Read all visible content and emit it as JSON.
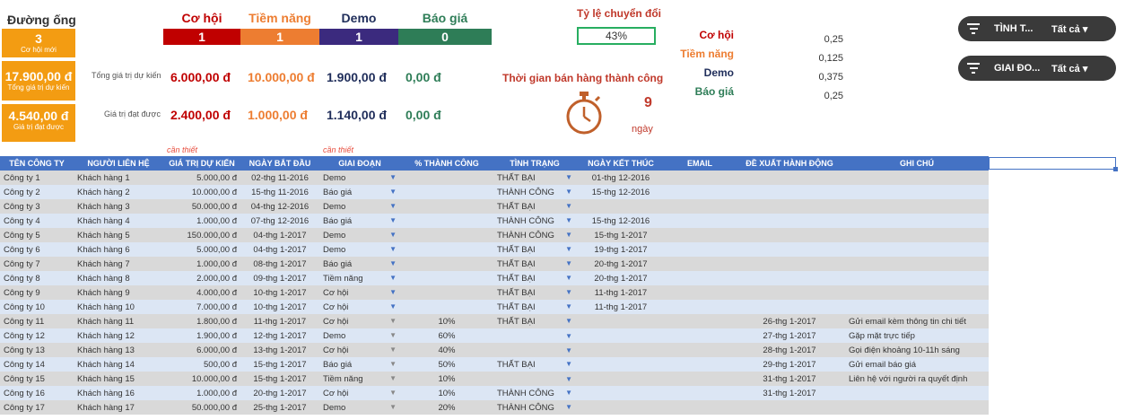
{
  "pipeline": {
    "title": "Đường ống",
    "kpis": [
      {
        "value": "3",
        "label": "Cơ hội mới"
      },
      {
        "value": "17.900,00 đ",
        "label": "Tổng giá trị dự kiến"
      },
      {
        "value": "4.540,00 đ",
        "label": "Giá trị đạt được"
      }
    ]
  },
  "stages": [
    {
      "name": "Cơ hội",
      "count": "1",
      "expected": "6.000,00 đ",
      "achieved": "2.400,00 đ",
      "color": "#c00000",
      "text_color": "#c00000"
    },
    {
      "name": "Tiềm năng",
      "count": "1",
      "expected": "10.000,00 đ",
      "achieved": "1.000,00 đ",
      "color": "#ed7d31",
      "text_color": "#ed7d31"
    },
    {
      "name": "Demo",
      "count": "1",
      "expected": "1.900,00 đ",
      "achieved": "1.140,00 đ",
      "color": "#3b2a7e",
      "text_color": "#1f2d5a"
    },
    {
      "name": "Báo giá",
      "count": "0",
      "expected": "0,00 đ",
      "achieved": "0,00 đ",
      "color": "#2e7d57",
      "text_color": "#2e7d57"
    }
  ],
  "row_labels": {
    "expected": "Tổng giá trị dự kiến",
    "achieved": "Giá trị đạt được"
  },
  "conversion": {
    "title": "Tỷ lệ chuyển đổi",
    "value": "43%"
  },
  "sales_cycle": {
    "title": "Thời gian bán hàng thành công",
    "value": "9",
    "unit": "ngày"
  },
  "rates": [
    {
      "label": "Cơ hội",
      "value": "0,25",
      "color": "#c00000"
    },
    {
      "label": "Tiềm năng",
      "value": "0,125",
      "color": "#ed7d31"
    },
    {
      "label": "Demo",
      "value": "0,375",
      "color": "#1f2d5a"
    },
    {
      "label": "Báo giá",
      "value": "0,25",
      "color": "#2e7d57"
    }
  ],
  "slicers": [
    {
      "name": "TÌNH T...",
      "value": "Tất cả"
    },
    {
      "name": "GIAI ĐO...",
      "value": "Tất cả"
    }
  ],
  "required_note": "cần thiết",
  "table": {
    "headers": [
      "TÊN CÔNG TY",
      "NGƯỜI LIÊN HỆ",
      "GIÁ TRỊ DỰ KIẾN",
      "NGÀY BẮT ĐẦU",
      "GIAI ĐOẠN",
      "% THÀNH CÔNG",
      "TÌNH TRẠNG",
      "NGÀY KẾT THÚC",
      "EMAIL",
      "ĐỀ XUẤT HÀNH ĐỘNG",
      "GHI CHÚ"
    ],
    "rows": [
      [
        "Công ty 1",
        "Khách hàng 1",
        "5.000,00 đ",
        "02-thg 11-2016",
        "Demo",
        "",
        "THẤT BẠI",
        "01-thg 12-2016",
        "",
        "",
        ""
      ],
      [
        "Công ty 2",
        "Khách hàng 2",
        "10.000,00 đ",
        "15-thg 11-2016",
        "Báo giá",
        "",
        "THÀNH CÔNG",
        "15-thg 12-2016",
        "",
        "",
        ""
      ],
      [
        "Công ty 3",
        "Khách hàng 3",
        "50.000,00 đ",
        "04-thg 12-2016",
        "Demo",
        "",
        "THẤT BẠI",
        "",
        "",
        "",
        ""
      ],
      [
        "Công ty 4",
        "Khách hàng 4",
        "1.000,00 đ",
        "07-thg 12-2016",
        "Báo giá",
        "",
        "THÀNH CÔNG",
        "15-thg 12-2016",
        "",
        "",
        ""
      ],
      [
        "Công ty 5",
        "Khách hàng 5",
        "150.000,00 đ",
        "04-thg 1-2017",
        "Demo",
        "",
        "THÀNH CÔNG",
        "15-thg 1-2017",
        "",
        "",
        ""
      ],
      [
        "Công ty 6",
        "Khách hàng 6",
        "5.000,00 đ",
        "04-thg 1-2017",
        "Demo",
        "",
        "THẤT BẠI",
        "19-thg 1-2017",
        "",
        "",
        ""
      ],
      [
        "Công ty 7",
        "Khách hàng 7",
        "1.000,00 đ",
        "08-thg 1-2017",
        "Báo giá",
        "",
        "THẤT BẠI",
        "20-thg 1-2017",
        "",
        "",
        ""
      ],
      [
        "Công ty 8",
        "Khách hàng 8",
        "2.000,00 đ",
        "09-thg 1-2017",
        "Tiềm năng",
        "",
        "THẤT BẠI",
        "20-thg 1-2017",
        "",
        "",
        ""
      ],
      [
        "Công ty 9",
        "Khách hàng 9",
        "4.000,00 đ",
        "10-thg 1-2017",
        "Cơ hội",
        "",
        "THẤT BẠI",
        "11-thg 1-2017",
        "",
        "",
        ""
      ],
      [
        "Công ty 10",
        "Khách hàng 10",
        "7.000,00 đ",
        "10-thg 1-2017",
        "Cơ hội",
        "",
        "THẤT BẠI",
        "11-thg 1-2017",
        "",
        "",
        ""
      ],
      [
        "Công ty 11",
        "Khách hàng 11",
        "1.800,00 đ",
        "11-thg 1-2017",
        "Cơ hội",
        "10%",
        "THẤT BẠI",
        "",
        "",
        "26-thg 1-2017",
        "Gửi email kèm thông tin chi tiết"
      ],
      [
        "Công ty 12",
        "Khách hàng 12",
        "1.900,00 đ",
        "12-thg 1-2017",
        "Demo",
        "60%",
        "",
        "",
        "",
        "27-thg 1-2017",
        "Gặp mặt trực tiếp"
      ],
      [
        "Công ty 13",
        "Khách hàng 13",
        "6.000,00 đ",
        "13-thg 1-2017",
        "Cơ hội",
        "40%",
        "",
        "",
        "",
        "28-thg 1-2017",
        "Gọi điện khoảng 10-11h sáng"
      ],
      [
        "Công ty 14",
        "Khách hàng 14",
        "500,00 đ",
        "15-thg 1-2017",
        "Báo giá",
        "50%",
        "THẤT BẠI",
        "",
        "",
        "29-thg 1-2017",
        "Gửi email báo giá"
      ],
      [
        "Công ty 15",
        "Khách hàng 15",
        "10.000,00 đ",
        "15-thg 1-2017",
        "Tiềm năng",
        "10%",
        "",
        "",
        "",
        "31-thg 1-2017",
        "Liên hệ với người ra quyết định"
      ],
      [
        "Công ty 16",
        "Khách hàng 16",
        "1.000,00 đ",
        "20-thg 1-2017",
        "Cơ hội",
        "10%",
        "THÀNH CÔNG",
        "",
        "",
        "31-thg 1-2017",
        ""
      ],
      [
        "Công ty 17",
        "Khách hàng 17",
        "50.000,00 đ",
        "25-thg 1-2017",
        "Demo",
        "20%",
        "THÀNH CÔNG",
        "",
        "",
        "",
        ""
      ]
    ]
  }
}
